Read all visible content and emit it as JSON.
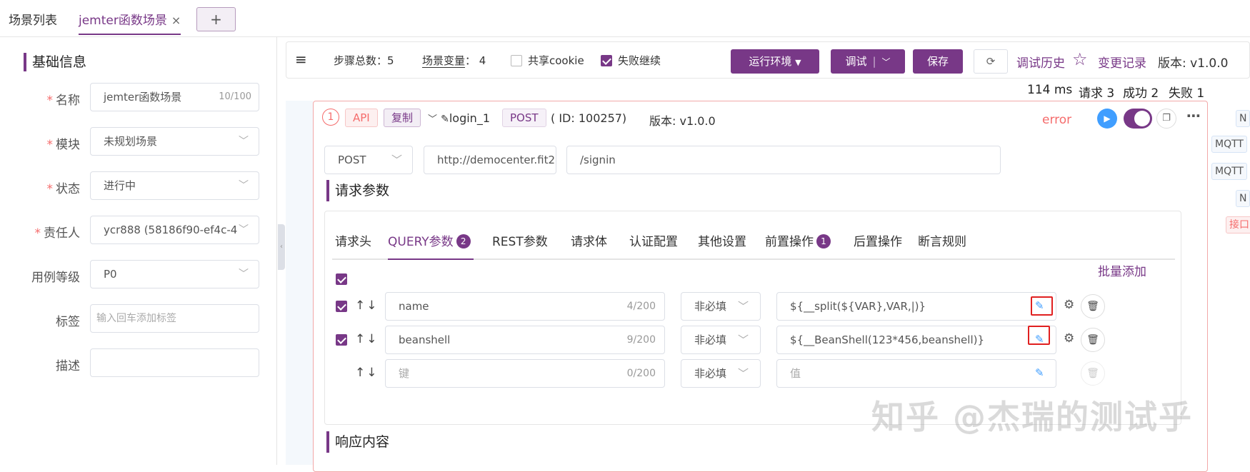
{
  "tabs": [
    {
      "label": "场景列表"
    },
    {
      "label": "jemter函数场景"
    }
  ],
  "close_glyph": "×",
  "add_tab_glyph": "+",
  "left_panel": {
    "section_title": "基础信息",
    "fields": {
      "name": {
        "label": "名称",
        "value": "jemter函数场景",
        "count": "10/100"
      },
      "module": {
        "label": "模块",
        "value": "未规划场景"
      },
      "status": {
        "label": "状态",
        "value": "进行中"
      },
      "owner": {
        "label": "责任人",
        "value": "ycr888 (58186f90-ef4c-4"
      },
      "level": {
        "label": "用例等级",
        "value": "P0"
      },
      "tags": {
        "label": "标签",
        "placeholder": "输入回车添加标签"
      },
      "desc": {
        "label": "描述"
      }
    },
    "required_mark": "*"
  },
  "toolbar": {
    "step_total_label": "步骤总数：",
    "step_total": "5",
    "scene_var_label": "场景变量",
    "scene_var_count": "：  4",
    "share_cookie": "共享cookie",
    "fail_continue": "失败继续",
    "run_env": "运行环境",
    "debug": "调试",
    "save": "保存",
    "debug_history": "调试历史",
    "change_log": "变更记录",
    "version": "版本: v1.0.0"
  },
  "stats": {
    "time": "114 ms",
    "requests": "请求 3",
    "success": "成功 2",
    "fail": "失败 1"
  },
  "step": {
    "index": "1",
    "api_tag": "API",
    "copy_tag": "复制",
    "name": "login_1",
    "method_tag": "POST",
    "id_text": "( ID: 100257)",
    "version": "版本: v1.0.0",
    "status": "error",
    "method": "POST",
    "domain": "http://democenter.fit2",
    "path": "/signin",
    "request_params_title": "请求参数",
    "response_title": "响应内容"
  },
  "request_tabs": [
    {
      "label": "请求头"
    },
    {
      "label": "QUERY参数",
      "badge": "2"
    },
    {
      "label": "REST参数"
    },
    {
      "label": "请求体"
    },
    {
      "label": "认证配置"
    },
    {
      "label": "其他设置"
    },
    {
      "label": "前置操作",
      "badge": "1"
    },
    {
      "label": "后置操作"
    },
    {
      "label": "断言规则"
    }
  ],
  "batch_add": "批量添加",
  "params": [
    {
      "key": "name",
      "count": "4/200",
      "required": "非必填",
      "value": "${__split(${VAR},VAR,|)}"
    },
    {
      "key": "beanshell",
      "count": "9/200",
      "required": "非必填",
      "value": "${__BeanShell(123*456,beanshell)}"
    },
    {
      "key": "键",
      "count": "0/200",
      "required": "非必填",
      "value": "值"
    }
  ],
  "side_tags": [
    "N",
    "MQTT",
    "MQTT",
    "N",
    "接口"
  ],
  "watermark": "知乎 @杰瑞的测试乎",
  "accent": "#783887"
}
